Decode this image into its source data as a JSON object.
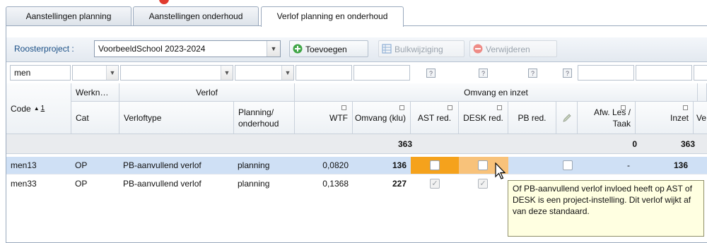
{
  "tabs": [
    {
      "label": "Aanstellingen planning",
      "active": false
    },
    {
      "label": "Aanstellingen onderhoud",
      "active": false
    },
    {
      "label": "Verlof planning en onderhoud",
      "active": true
    }
  ],
  "toolbar": {
    "roosterproject_label": "Roosterproject :",
    "roosterproject_value": "VoorbeeldSchool 2023-2024",
    "add_label": "Toevoegen",
    "bulk_label": "Bulkwijziging",
    "delete_label": "Verwijderen"
  },
  "filter": {
    "code_value": "men",
    "question_mark": "?"
  },
  "headers": {
    "code": "Code",
    "sort_index": "1",
    "werkn": "Werkn…",
    "cat": "Cat",
    "verlof": "Verlof",
    "verloftype": "Verloftype",
    "planning_onderhoud": "Planning/ onderhoud",
    "omvang_inzet": "Omvang en inzet",
    "wtf": "WTF",
    "omvang_klu": "Omvang (klu)",
    "ast_red": "AST red.",
    "desk_red": "DESK red.",
    "pb_red": "PB red.",
    "afw": "Afw. Les / Taak",
    "inzet": "Inzet",
    "v": "Ve"
  },
  "totals": {
    "omvang": "363",
    "afw": "0",
    "inzet": "363"
  },
  "rows": [
    {
      "code": "men13",
      "cat": "OP",
      "verloftype": "PB-aanvullend verlof",
      "planning": "planning",
      "wtf": "0,0820",
      "omvang": "136",
      "ast": false,
      "desk": false,
      "afw": "-",
      "inzet": "136"
    },
    {
      "code": "men33",
      "cat": "OP",
      "verloftype": "PB-aanvullend verlof",
      "planning": "planning",
      "wtf": "0,1368",
      "omvang": "227",
      "ast": true,
      "desk": true
    }
  ],
  "tooltip": "Of PB-aanvullend verlof invloed heeft op AST of DESK is een project-instelling. Dit verlof wijkt af van deze standaard.",
  "colors": {
    "selected_row": "#cfe0f5",
    "ast_highlight": "#f5a21c",
    "desk_highlight": "#f8c27a",
    "tooltip_bg": "#ffffe1",
    "tab_border": "#9aa9bd"
  }
}
